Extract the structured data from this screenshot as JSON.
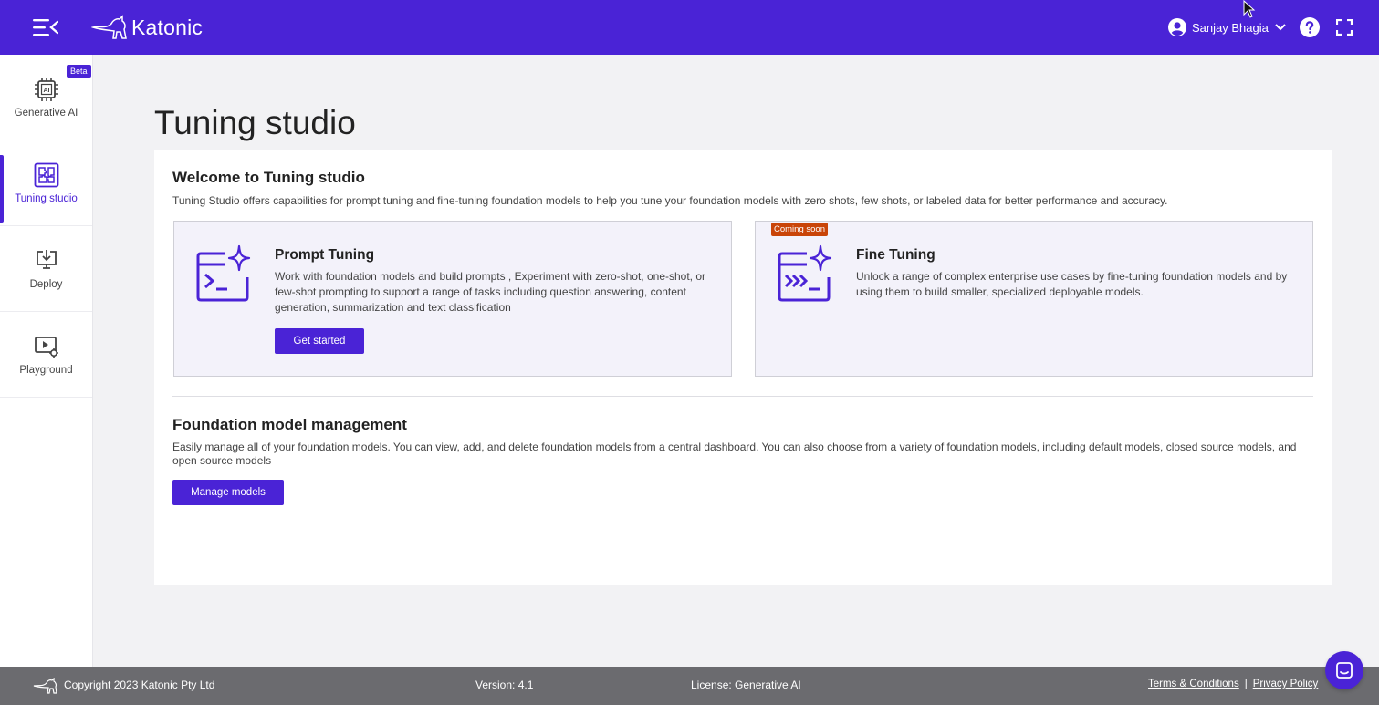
{
  "header": {
    "brand": "Katonic",
    "user_name": "Sanjay Bhagia"
  },
  "sidebar": {
    "items": [
      {
        "label": "Generative AI",
        "badge": "Beta",
        "icon": "ai-chip-icon"
      },
      {
        "label": "Tuning studio",
        "icon": "puzzle-icon",
        "active": true
      },
      {
        "label": "Deploy",
        "icon": "deploy-icon"
      },
      {
        "label": "Playground",
        "icon": "playground-icon"
      }
    ]
  },
  "main": {
    "page_title": "Tuning studio",
    "welcome": {
      "title": "Welcome to Tuning studio",
      "description": "Tuning Studio offers capabilities for prompt tuning and fine-tuning foundation models to help you tune your foundation models with zero shots, few shots, or labeled data for better performance and accuracy."
    },
    "cards": [
      {
        "title": "Prompt Tuning",
        "description": "Work with foundation models and build prompts , Experiment with zero-shot, one-shot, or few-shot prompting to support a range of tasks including question answering, content generation, summarization and text classification",
        "button": "Get started",
        "icon": "prompt-terminal-icon"
      },
      {
        "title": "Fine Tuning",
        "description": "Unlock a range of complex enterprise use cases by fine-tuning foundation models and by using them to build smaller, specialized deployable models.",
        "badge": "Coming soon",
        "icon": "fine-tuning-terminal-icon"
      }
    ],
    "foundation": {
      "title": "Foundation model management",
      "description": "Easily manage all of your foundation models. You can view, add, and delete foundation models from a central dashboard. You can also choose from a variety of foundation models, including default models, closed source models, and open source models",
      "button": "Manage models"
    }
  },
  "footer": {
    "copyright": "Copyright 2023 Katonic Pty Ltd",
    "version": "Version: 4.1",
    "license": "License: Generative AI",
    "terms": "Terms & Conditions",
    "separator": "|",
    "privacy": "Privacy Policy"
  },
  "colors": {
    "brand": "#4a23d6",
    "badge_coming_soon": "#c94508",
    "footer": "#6b6b6f"
  }
}
